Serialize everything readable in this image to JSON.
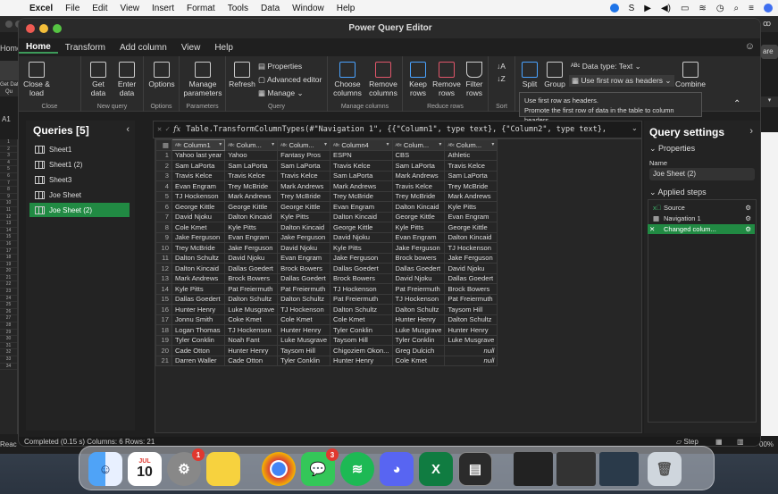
{
  "menubar": {
    "apple": "",
    "items": [
      "Excel",
      "File",
      "Edit",
      "View",
      "Insert",
      "Format",
      "Tools",
      "Data",
      "Window",
      "Help"
    ]
  },
  "bg_excel": {
    "home_fragment": "Home",
    "share_fragment": "are",
    "getdata_fragment": "Get Dat",
    "qu_fragment": "Qu",
    "cell_ref": "A1",
    "ready_fragment": "Reac",
    "zoom_fragment": "00%",
    "row_numbers": [
      "1",
      "2",
      "3",
      "4",
      "5",
      "6",
      "7",
      "8",
      "9",
      "10",
      "11",
      "12",
      "13",
      "14",
      "15",
      "16",
      "17",
      "18",
      "19",
      "20",
      "21",
      "22",
      "23",
      "24",
      "25",
      "26",
      "27",
      "28",
      "29",
      "30",
      "31",
      "32",
      "33",
      "34"
    ]
  },
  "pq": {
    "title": "Power Query Editor",
    "tabs": [
      "Home",
      "Transform",
      "Add column",
      "View",
      "Help"
    ],
    "ribbon": {
      "close_load": "Close & load",
      "get_data": "Get data",
      "enter_data": "Enter data",
      "options": "Options",
      "manage_params": "Manage parameters",
      "refresh": "Refresh",
      "properties": "Properties",
      "advanced_editor": "Advanced editor",
      "manage": "Manage",
      "choose_columns": "Choose columns",
      "remove_columns": "Remove columns",
      "keep_rows": "Keep rows",
      "remove_rows": "Remove rows",
      "filter_rows": "Filter rows",
      "split": "Split",
      "group": "Group",
      "data_type": "Data type: Text",
      "use_first_row": "Use first row as headers",
      "combine": "Combine",
      "groups": {
        "close": "Close",
        "new_query": "New query",
        "options": "Options",
        "parameters": "Parameters",
        "query": "Query",
        "manage_columns": "Manage columns",
        "reduce_rows": "Reduce rows",
        "sort": "Sort"
      }
    },
    "tooltip": {
      "line1": "Use first row as headers.",
      "line2": "Promote the first row of data in the table to column headers."
    },
    "queries": {
      "header": "Queries [5]",
      "items": [
        "Sheet1",
        "Sheet1 (2)",
        "Sheet3",
        "Joe Sheet",
        "Joe Sheet (2)"
      ]
    },
    "formula": {
      "fx": "fx",
      "text": "Table.TransformColumnTypes(#\"Navigation 1\", {{\"Column1\", type text}, {\"Column2\", type text},"
    },
    "columns": [
      "Column1",
      "Colum...",
      "Colum...",
      "Column4",
      "Colum...",
      "Colum..."
    ],
    "rows": [
      [
        "1",
        "Yahoo last year",
        "Yahoo",
        "Fantasy Pros",
        "ESPN",
        "CBS",
        "Athletic"
      ],
      [
        "2",
        "Sam LaPorta",
        "Sam LaPorta",
        "Sam LaPorta",
        "Travis Kelce",
        "Sam LaPorta",
        "Travis Kelce"
      ],
      [
        "3",
        "Travis Kelce",
        "Travis Kelce",
        "Travis Kelce",
        "Sam LaPorta",
        "Mark Andrews",
        "Sam LaPorta"
      ],
      [
        "4",
        "Evan Engram",
        "Trey McBride",
        "Mark Andrews",
        "Mark Andrews",
        "Travis Kelce",
        "Trey McBride"
      ],
      [
        "5",
        "TJ Hockenson",
        "Mark Andrews",
        "Trey McBride",
        "Trey McBride",
        "Trey McBride",
        "Mark Andrews"
      ],
      [
        "6",
        "George Kittle",
        "George Kittle",
        "George Kittle",
        "Evan Engram",
        "Dalton Kincaid",
        "Kyle Pitts"
      ],
      [
        "7",
        "David Njoku",
        "Dalton Kincaid",
        "Kyle Pitts",
        "Dalton Kincaid",
        "George Kittle",
        "Evan Engram"
      ],
      [
        "8",
        "Cole Kmet",
        "Kyle Pitts",
        "Dalton Kincaid",
        "George Kittle",
        "Kyle Pitts",
        "George Kittle"
      ],
      [
        "9",
        "Jake Ferguson",
        "Evan Engram",
        "Jake Ferguson",
        "David Njoku",
        "Evan Engram",
        "Dalton Kincaid"
      ],
      [
        "10",
        "Trey McBride",
        "Jake Ferguson",
        "David Njoku",
        "Kyle Pitts",
        "Jake Ferguson",
        "TJ Hockenson"
      ],
      [
        "11",
        "Dalton Schultz",
        "David Njoku",
        "Evan Engram",
        "Jake Ferguson",
        "Brock bowers",
        "Jake Ferguson"
      ],
      [
        "12",
        "Dalton Kincaid",
        "Dallas Goedert",
        "Brock Bowers",
        "Dallas Goedert",
        "Dallas Goedert",
        "David Njoku"
      ],
      [
        "13",
        "Mark Andrews",
        "Brock Bowers",
        "Dallas Goedert",
        "Brock Bowers",
        "David Njoku",
        "Dallas Goedert"
      ],
      [
        "14",
        "Kyle Pitts",
        "Pat Freiermuth",
        "Pat Freiermuth",
        "TJ Hockenson",
        "Pat Freiermuth",
        "Brock Bowers"
      ],
      [
        "15",
        "Dallas Goedert",
        "Dalton Schultz",
        "Dalton Schultz",
        "Pat Freiermuth",
        "TJ Hockenson",
        "Pat Freiermuth"
      ],
      [
        "16",
        "Hunter Henry",
        "Luke Musgrave",
        "TJ Hockenson",
        "Dalton Schultz",
        "Dalton Schultz",
        "Taysom Hill"
      ],
      [
        "17",
        "Jonnu Smith",
        "Coke Kmet",
        "Cole Kmet",
        "Cole Kmet",
        "Hunter Henry",
        "Dalton Schultz"
      ],
      [
        "18",
        "Logan Thomas",
        "TJ Hockenson",
        "Hunter Henry",
        "Tyler Conklin",
        "Luke Musgrave",
        "Hunter Henry"
      ],
      [
        "19",
        "Tyler Conklin",
        "Noah Fant",
        "Luke Musgrave",
        "Taysom Hill",
        "Tyler Conklin",
        "Luke Musgrave"
      ],
      [
        "20",
        "Cade Otton",
        "Hunter Henry",
        "Taysom Hill",
        "Chigoziem Okon...",
        "Greg Dulcich",
        "null"
      ],
      [
        "21",
        "Darren Waller",
        "Cade Otton",
        "Tyler Conklin",
        "Hunter Henry",
        "Cole Kmet",
        "null"
      ]
    ],
    "settings": {
      "header": "Query settings",
      "properties": "Properties",
      "name_label": "Name",
      "name_value": "Joe Sheet (2)",
      "applied_steps": "Applied steps",
      "steps": [
        "Source",
        "Navigation 1",
        "Changed colum..."
      ]
    },
    "status": {
      "left": "Completed (0.15 s)   Columns: 6   Rows: 21",
      "step": "Step"
    }
  },
  "dock": {
    "calendar_month": "JUL",
    "calendar_day": "10",
    "settings_badge": "1",
    "messages_badge": "3",
    "excel_letter": "X"
  },
  "colors": {
    "accent_green": "#218a43",
    "bg": "#1f1f1f"
  }
}
